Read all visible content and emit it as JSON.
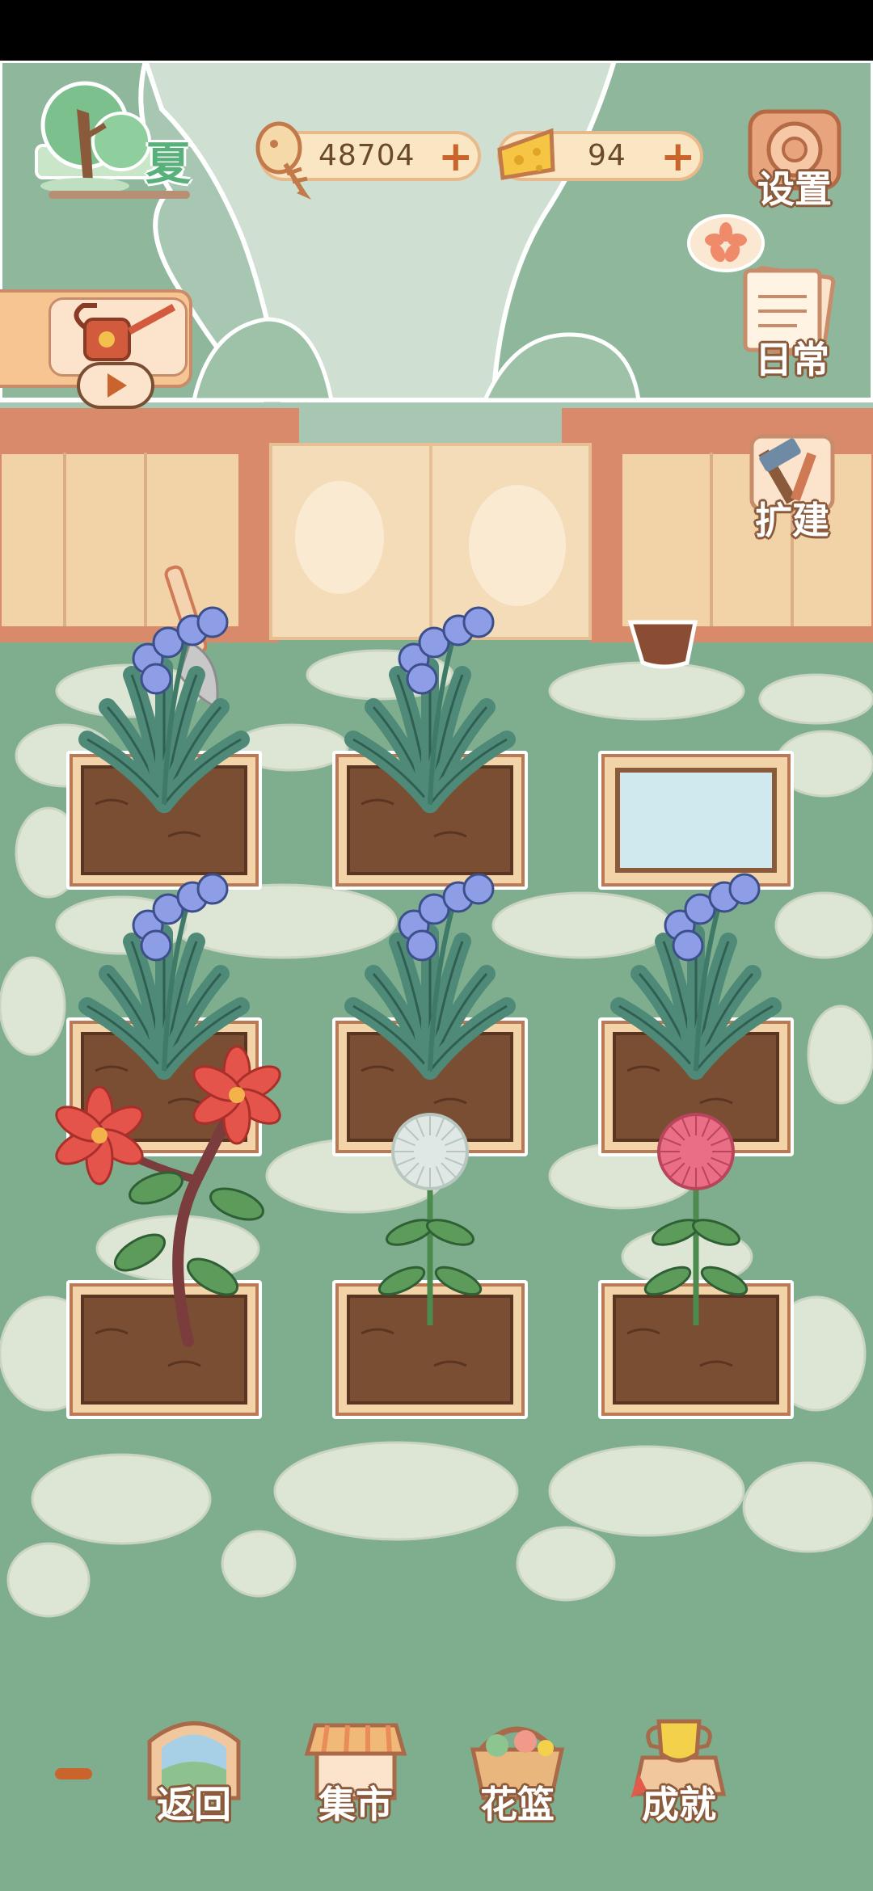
{
  "season": {
    "label": "夏"
  },
  "currency": {
    "fish_bones": {
      "value": "48704",
      "icon": "fish-bone-icon"
    },
    "cheese": {
      "value": "94",
      "icon": "cheese-icon"
    }
  },
  "side_buttons": {
    "settings": "设置",
    "daily": "日常",
    "expand": "扩建"
  },
  "bottom_nav": {
    "back": "返回",
    "market": "集市",
    "basket": "花篮",
    "achievements": "成就"
  },
  "garden": {
    "plots": [
      {
        "row": 1,
        "col": 1,
        "content": "bluebell"
      },
      {
        "row": 1,
        "col": 2,
        "content": "bluebell"
      },
      {
        "row": 1,
        "col": 3,
        "content": "water"
      },
      {
        "row": 2,
        "col": 1,
        "content": "bluebell"
      },
      {
        "row": 2,
        "col": 2,
        "content": "bluebell"
      },
      {
        "row": 2,
        "col": 3,
        "content": "bluebell"
      },
      {
        "row": 3,
        "col": 1,
        "content": "red-lily"
      },
      {
        "row": 3,
        "col": 2,
        "content": "white-dandelion"
      },
      {
        "row": 3,
        "col": 3,
        "content": "pink-chrysanthemum"
      }
    ]
  },
  "colors": {
    "grass": "#7fae8e",
    "stone": "#dfe6d6",
    "soil": "#7a4e33",
    "planter_frame": "#f3d3a8",
    "fence": "#f0d2a6",
    "accent_orange": "#c9642c"
  }
}
